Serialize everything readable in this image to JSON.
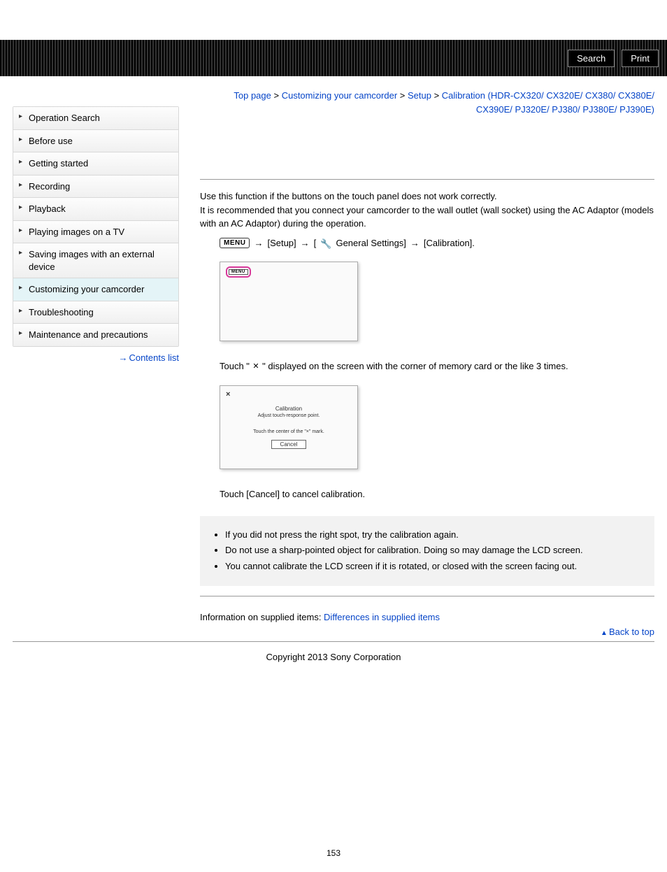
{
  "toolbar": {
    "search": "Search",
    "print": "Print"
  },
  "sidebar": {
    "items": [
      {
        "label": "Operation Search"
      },
      {
        "label": "Before use"
      },
      {
        "label": "Getting started"
      },
      {
        "label": "Recording"
      },
      {
        "label": "Playback"
      },
      {
        "label": "Playing images on a TV"
      },
      {
        "label": "Saving images with an external device"
      },
      {
        "label": "Customizing your camcorder"
      },
      {
        "label": "Troubleshooting"
      },
      {
        "label": "Maintenance and precautions"
      }
    ],
    "contents_link": "Contents list"
  },
  "breadcrumb": {
    "top": "Top page",
    "sep": " > ",
    "customize": "Customizing your camcorder",
    "setup": "Setup",
    "current": "Calibration (HDR-CX320/ CX320E/ CX380/ CX380E/ CX390E/ PJ320E/ PJ380/ PJ380E/ PJ390E)"
  },
  "body": {
    "p1": "Use this function if the buttons on the touch panel does not work correctly.",
    "p2": "It is recommended that you connect your camcorder to the wall outlet (wall socket) using the AC Adaptor (models with an AC Adaptor) during the operation.",
    "menu_btn": "MENU",
    "step_setup": "[Setup]",
    "step_general": "General Settings]",
    "step_bracket": "[",
    "step_calibration": "[Calibration].",
    "touch_pre": "Touch \" ",
    "touch_post": " \" displayed on the screen with the corner of memory card or the like 3 times.",
    "cancel_line": "Touch [Cancel] to cancel calibration."
  },
  "mock1": {
    "menu": "MENU"
  },
  "mock2": {
    "x": "×",
    "title": "Calibration",
    "sub": "Adjust touch-response point.",
    "instr": "Touch the center of the \"×\" mark.",
    "cancel": "Cancel"
  },
  "notes": [
    "If you did not press the right spot, try the calibration again.",
    "Do not use a sharp-pointed object for calibration. Doing so may damage the LCD screen.",
    "You cannot calibrate the LCD screen if it is rotated, or closed with the screen facing out."
  ],
  "supplied": {
    "prefix": "Information on supplied items: ",
    "link": "Differences in supplied items"
  },
  "back_to_top": "Back to top",
  "copyright": "Copyright 2013 Sony Corporation",
  "page_number": "153"
}
